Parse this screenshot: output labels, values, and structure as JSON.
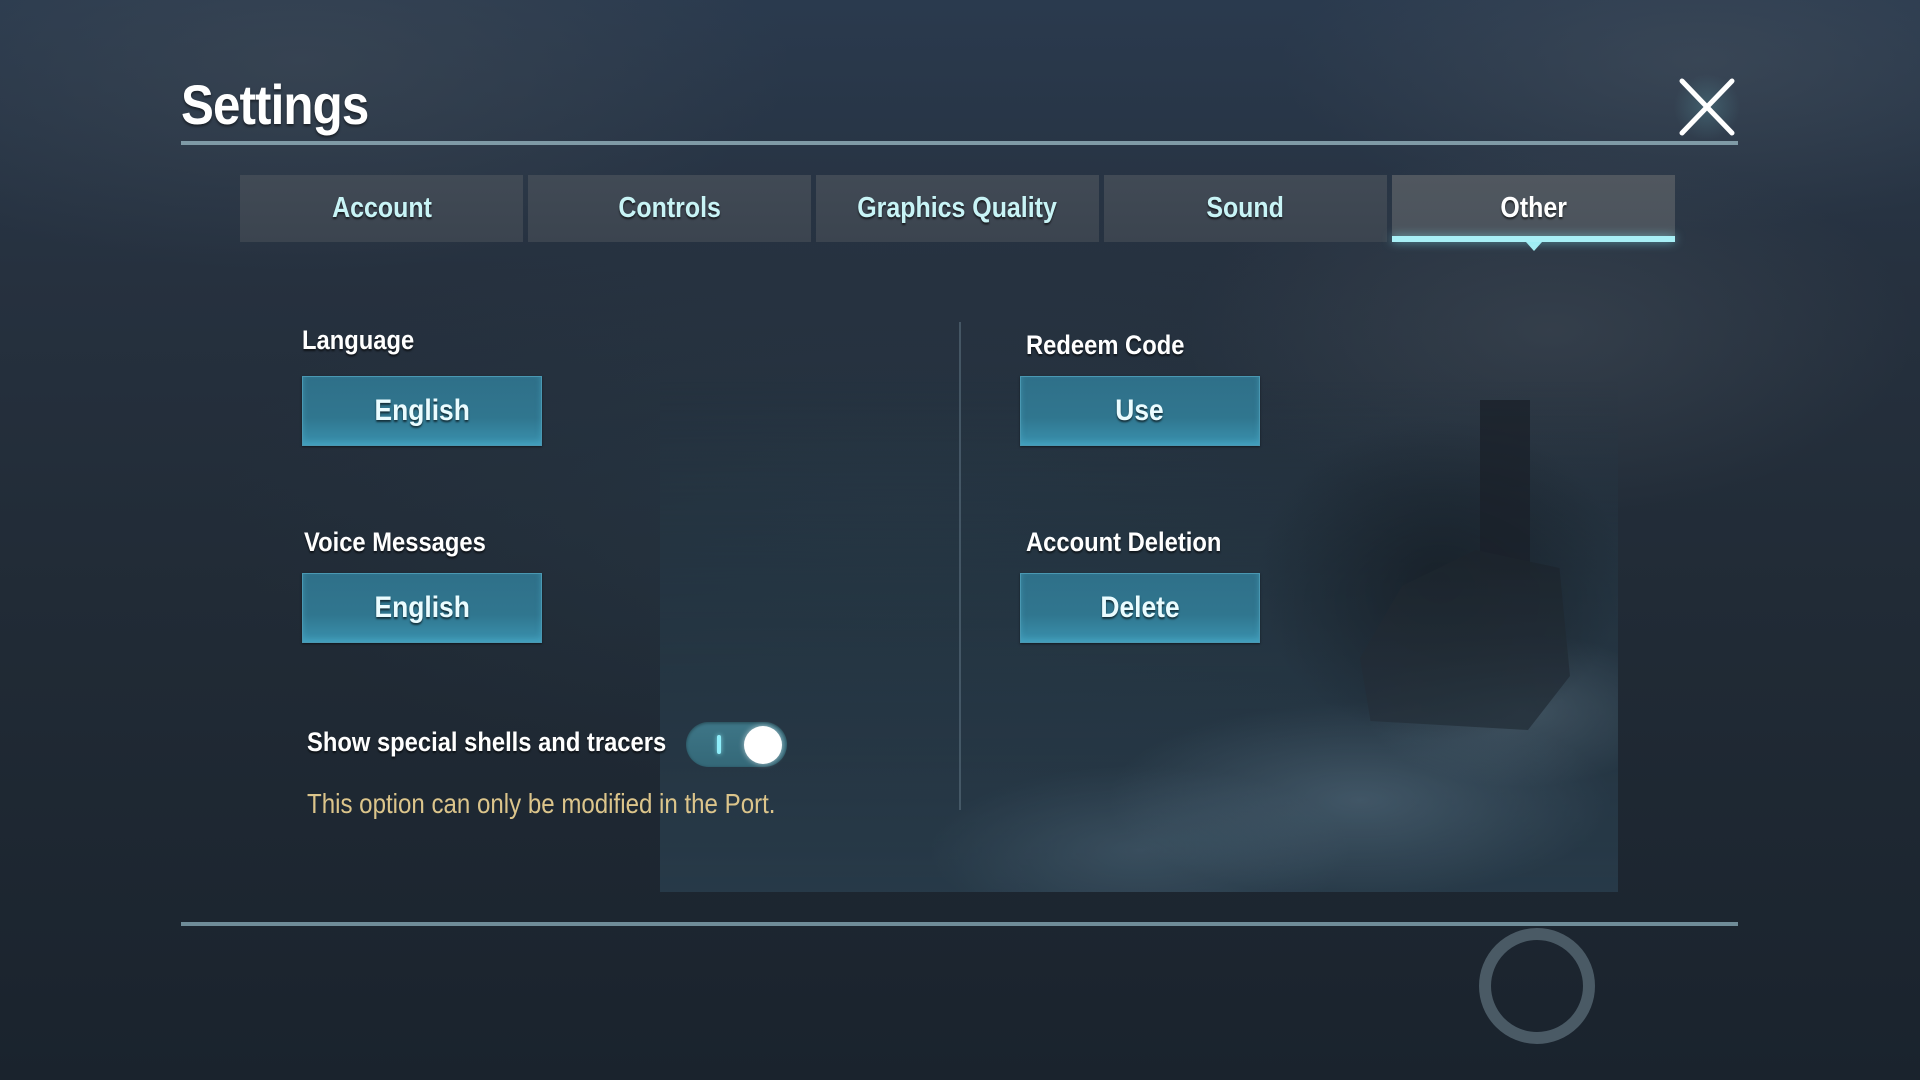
{
  "header": {
    "title": "Settings",
    "close_icon": "close-x-icon"
  },
  "tabs": [
    {
      "label": "Account",
      "active": false
    },
    {
      "label": "Controls",
      "active": false
    },
    {
      "label": "Graphics Quality",
      "active": false
    },
    {
      "label": "Sound",
      "active": false
    },
    {
      "label": "Other",
      "active": true
    }
  ],
  "other": {
    "language": {
      "label": "Language",
      "value": "English"
    },
    "voice_messages": {
      "label": "Voice Messages",
      "value": "English"
    },
    "special_shells": {
      "label": "Show special shells and tracers",
      "enabled": true,
      "note": "This option can only be modified in the Port."
    },
    "redeem_code": {
      "label": "Redeem Code",
      "button": "Use"
    },
    "account_deletion": {
      "label": "Account Deletion",
      "button": "Delete"
    }
  },
  "colors": {
    "accent": "#a8f0f6",
    "button": "#30768f",
    "note": "#dcc58b",
    "tab_text": "#c8f4f6"
  }
}
